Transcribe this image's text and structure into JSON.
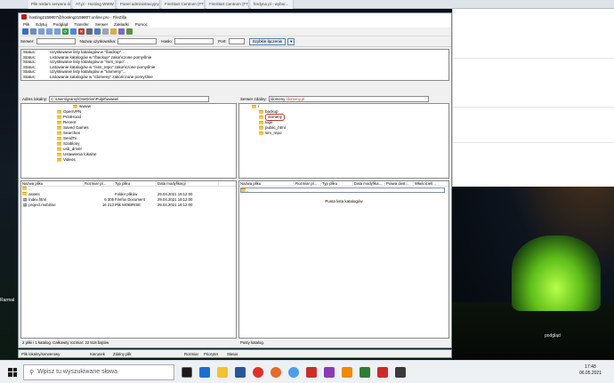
{
  "browser": {
    "menu": [
      "Plik",
      "Edycja",
      "Widok",
      "Historia",
      "Zakładki",
      "Narzędzia",
      "Pomoc"
    ],
    "tabs": [
      "Plik reklam serwera do serwerow",
      "AT.pl - Hosting WWW",
      "Panel administracyjny",
      "FireStart Centrum (FTP...",
      "FireStart Centrum (FTP...",
      "ferdyna pl - wybor..."
    ],
    "side_text": [
      "podgląd"
    ]
  },
  "filezilla": {
    "title": "hosting2159807@hosting2159807.online.pro - FileZilla",
    "menu": [
      "Plik",
      "Edytuj",
      "Podgląd",
      "Transfer",
      "Serwer",
      "Zakładki",
      "Pomoc"
    ],
    "quickconnect": {
      "server_label": "Serwer:",
      "user_label": "Nazwa użytkownika:",
      "pass_label": "Hasło:",
      "port_label": "Port:",
      "button": "Szybkie łączenie"
    },
    "log": [
      {
        "k": "Status:",
        "v": "Uzyskiwanie listy katalogów w \"/backup\"..."
      },
      {
        "k": "Status:",
        "v": "Listowanie katalogów w \"/backup\" zakończone pomyślnie"
      },
      {
        "k": "Status:",
        "v": "Uzyskiwanie listy katalogów w \"/sim_repo\"..."
      },
      {
        "k": "Status:",
        "v": "Listowanie katalogów w \"/sim_repo\" zakończone pomyślnie"
      },
      {
        "k": "Status:",
        "v": "Uzyskiwanie listy katalogów w \"/domeny\"..."
      },
      {
        "k": "Status:",
        "v": "Listowanie katalogów w \"/domeny\" zakończone pomyślnie"
      }
    ],
    "local": {
      "addr_label": "Adres lokalny:",
      "addr_value": "C:\\Users\\gramy\\OneDrive\\Pulpit\\wwww\\",
      "tree": [
        "wwww",
        "OpenVPN",
        "PrintHood",
        "Recent",
        "Saved Games",
        "Searches",
        "SendTo",
        "Szablony",
        "usb_driver",
        "Ustawienia lokalne",
        "Videos"
      ],
      "columns": [
        "Nazwa pliku",
        "Rozmiar pl...",
        "Typ pliku",
        "Data modyfikacji"
      ],
      "files": [
        {
          "name": "..",
          "size": "",
          "type": "",
          "date": ""
        },
        {
          "name": "assets",
          "size": "",
          "type": "Folder plików",
          "date": "29.04.2021 19:12:00"
        },
        {
          "name": "index.html",
          "size": "6 305",
          "type": "Firefox Document",
          "date": "29.04.2021 19:12:00"
        },
        {
          "name": "project.mobirise",
          "size": "16 213",
          "type": "Plik MOBIRISE",
          "date": "29.04.2021 19:12:00"
        }
      ],
      "status": "2 pliki i 1 katalog. Całkowity rozmiar: 22 518 bajtów"
    },
    "remote": {
      "addr_label": "Serwer zdalny:",
      "addr_value": "/domeny",
      "addr_extra": "/domeny.pl",
      "tree": [
        "/",
        "backup",
        "domeny",
        "logs",
        "public_html",
        "sim_repo"
      ],
      "columns": [
        "Nazwa pliku",
        "Rozmiar pl...",
        "Typ pliku",
        "Data modyfika...",
        "Prawa dost...",
        "Właściciel/..."
      ],
      "first_row": "..",
      "empty": "Pusta lista katalogów",
      "status": "Pusty katalog."
    },
    "queue": {
      "columns": [
        "Plik lokalny/serwerowy",
        "Kierunek",
        "Zdalny plik",
        "Rozmiar",
        "Priorytet",
        "Status"
      ]
    }
  },
  "desktop": {
    "icons": [
      "Rarmal"
    ]
  },
  "taskbar": {
    "search_placeholder": "Wpisz tu wyszukiwane słowa",
    "time": "17:48",
    "date": "06.05.2021"
  }
}
